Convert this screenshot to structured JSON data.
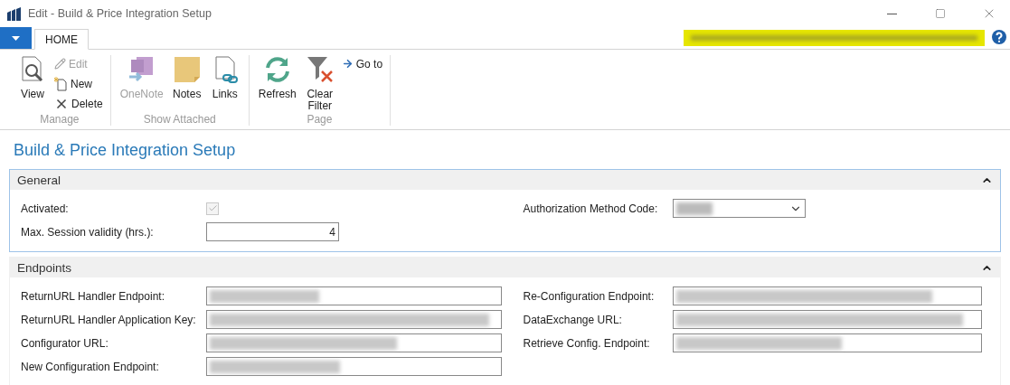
{
  "window": {
    "title": "Edit - Build & Price Integration Setup",
    "user_redacted": true
  },
  "ribbon": {
    "tabs": [
      {
        "label": "HOME",
        "selected": true
      }
    ],
    "groups": [
      {
        "label": "Manage",
        "items": [
          {
            "kind": "large",
            "label": "View",
            "disabled": false
          },
          {
            "kind": "small",
            "label": "Edit",
            "disabled": true
          },
          {
            "kind": "small",
            "label": "New",
            "disabled": false
          },
          {
            "kind": "small",
            "label": "Delete",
            "disabled": false
          }
        ]
      },
      {
        "label": "Show Attached",
        "items": [
          {
            "kind": "large",
            "label": "OneNote",
            "disabled": true
          },
          {
            "kind": "large",
            "label": "Notes",
            "disabled": false
          },
          {
            "kind": "large",
            "label": "Links",
            "disabled": false
          }
        ]
      },
      {
        "label": "Page",
        "items": [
          {
            "kind": "large",
            "label": "Refresh",
            "disabled": false
          },
          {
            "kind": "large",
            "label": "Clear\nFilter",
            "disabled": false
          },
          {
            "kind": "small",
            "label": "Go to",
            "disabled": false
          }
        ]
      }
    ]
  },
  "page_title": "Build & Price Integration Setup",
  "sections": [
    {
      "title": "General",
      "expanded": true,
      "focused": true,
      "left": [
        {
          "kind": "checkbox",
          "label": "Activated:",
          "checked": true,
          "disabled": true
        },
        {
          "kind": "number",
          "label": "Max. Session validity (hrs.):",
          "value": "4"
        }
      ],
      "right": [
        {
          "kind": "dropdown",
          "label": "Authorization Method Code:",
          "redacted": true
        }
      ]
    },
    {
      "title": "Endpoints",
      "expanded": true,
      "focused": false,
      "left": [
        {
          "kind": "text",
          "label": "ReturnURL Handler Endpoint:",
          "redacted": true
        },
        {
          "kind": "text",
          "label": "ReturnURL Handler Application Key:",
          "redacted": true
        },
        {
          "kind": "text",
          "label": "Configurator URL:",
          "redacted": true
        },
        {
          "kind": "text",
          "label": "New Configuration Endpoint:",
          "redacted": true
        }
      ],
      "right": [
        {
          "kind": "text",
          "label": "Re-Configuration Endpoint:",
          "redacted": true
        },
        {
          "kind": "text",
          "label": "DataExchange URL:",
          "redacted": true
        },
        {
          "kind": "text",
          "label": "Retrieve Config. Endpoint:",
          "redacted": true
        }
      ]
    }
  ]
}
